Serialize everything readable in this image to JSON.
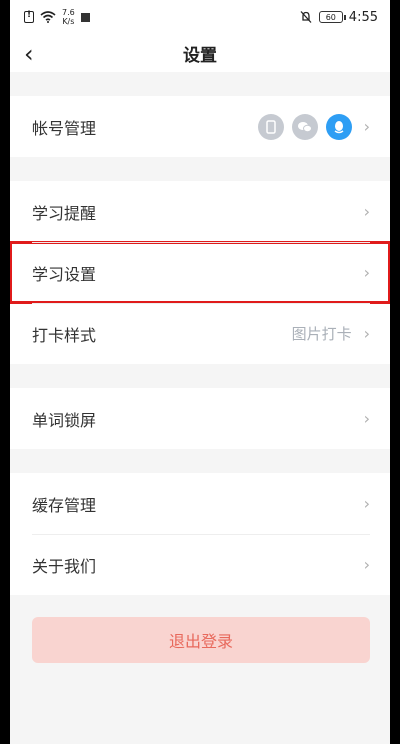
{
  "status_bar": {
    "net_speed_top": "7.6",
    "net_speed_bottom": "K/s",
    "battery": "60",
    "time": "4:55"
  },
  "header": {
    "title": "设置"
  },
  "groups": {
    "account": {
      "label": "帐号管理"
    },
    "study": {
      "reminder": "学习提醒",
      "settings": "学习设置",
      "checkin_style": "打卡样式",
      "checkin_value": "图片打卡"
    },
    "lockscreen": {
      "label": "单词锁屏"
    },
    "misc": {
      "cache": "缓存管理",
      "about": "关于我们"
    }
  },
  "logout_label": "退出登录",
  "colors": {
    "highlight": "#e01b1b",
    "logout_bg": "#f9d4d0",
    "logout_text": "#e8695c",
    "qq_blue": "#2e9ef4"
  }
}
